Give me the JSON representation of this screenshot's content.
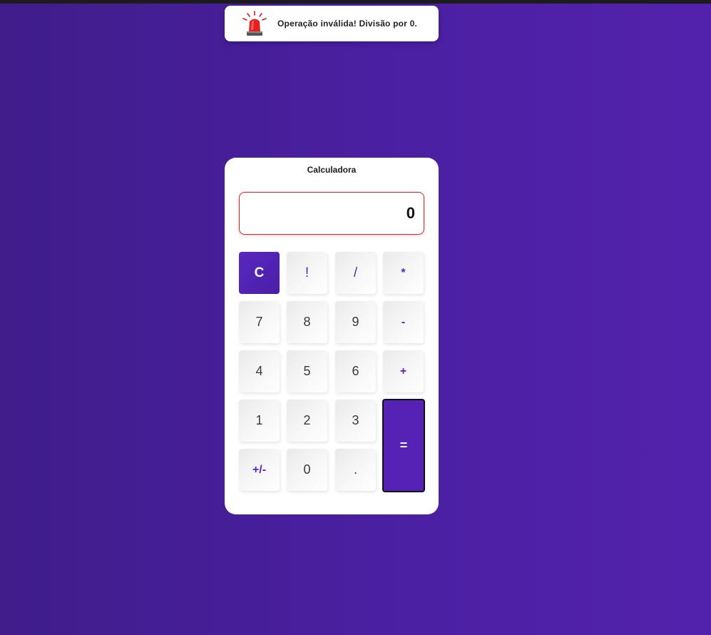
{
  "toast": {
    "icon": "siren-icon",
    "message": "Operação inválida! Divisão por 0."
  },
  "calculator": {
    "title": "Calculadora",
    "display": "0",
    "keys": {
      "clear": "C",
      "factorial": "!",
      "divide": "/",
      "multiply": "*",
      "seven": "7",
      "eight": "8",
      "nine": "9",
      "minus": "-",
      "four": "4",
      "five": "5",
      "six": "6",
      "plus": "+",
      "one": "1",
      "two": "2",
      "three": "3",
      "equals": "=",
      "sign": "+/-",
      "zero": "0",
      "decimal": "."
    }
  },
  "colors": {
    "accent": "#5522b5",
    "background": "#4a1fa0",
    "error_border": "#e02020"
  }
}
